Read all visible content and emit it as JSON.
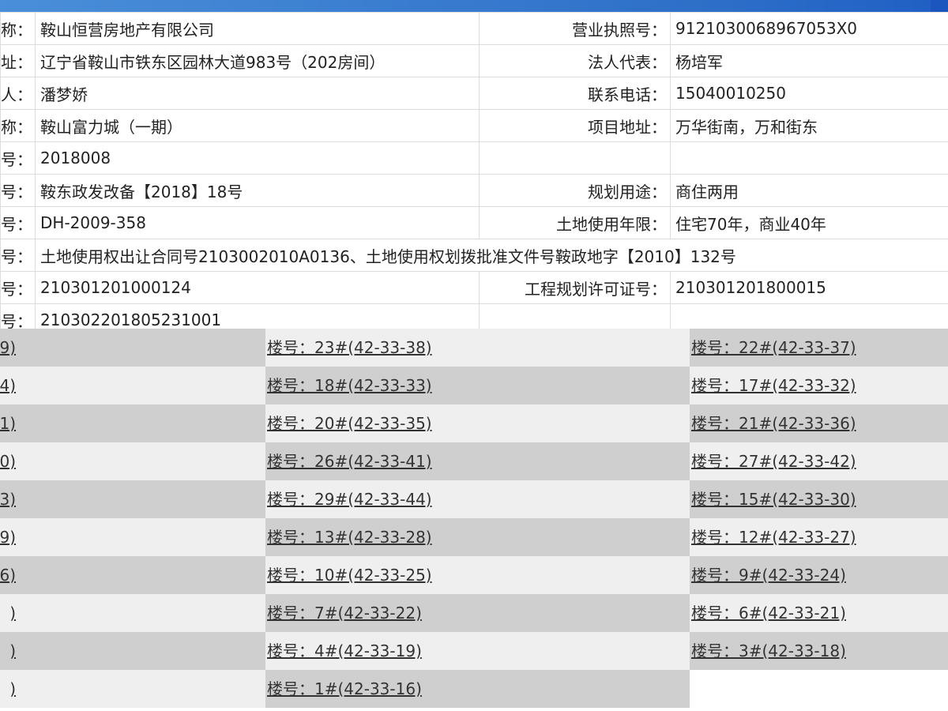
{
  "info_rows": [
    {
      "l1": "称：",
      "v1": "鞍山恒营房地产有限公司",
      "l2": "营业执照号：",
      "v2": "9121030068967053X0"
    },
    {
      "l1": "址：",
      "v1": "辽宁省鞍山市铁东区园林大道983号（202房间）",
      "l2": "法人代表：",
      "v2": "杨培军"
    },
    {
      "l1": "人：",
      "v1": "潘梦娇",
      "l2": "联系电话：",
      "v2": "15040010250"
    },
    {
      "l1": "称：",
      "v1": "鞍山富力城（一期）",
      "l2": "项目地址：",
      "v2": "万华街南，万和街东"
    },
    {
      "l1": "号：",
      "v1": "2018008",
      "l2": "",
      "v2": ""
    },
    {
      "l1": "号：",
      "v1": "鞍东政发改备【2018】18号",
      "l2": "规划用途：",
      "v2": "商住两用"
    },
    {
      "l1": "号：",
      "v1": "DH-2009-358",
      "l2": "土地使用年限：",
      "v2": "住宅70年，商业40年"
    },
    {
      "l1": "号：",
      "v1": "土地使用权出让合同号2103002010A0136、土地使用权划拨批准文件号鞍政地字【2010】132号",
      "l2": "",
      "v2": "",
      "span": true
    },
    {
      "l1": "号：",
      "v1": "210301201000124",
      "l2": "工程规划许可证号：",
      "v2": "210301201800015"
    },
    {
      "l1": "号：",
      "v1": "210302201805231001",
      "l2": "",
      "v2": ""
    }
  ],
  "buildings": [
    {
      "c1": "9)",
      "c2": "楼号：23#(42-33-38)",
      "c3": "楼号：22#(42-33-37)"
    },
    {
      "c1": "4)",
      "c2": "楼号：18#(42-33-33)",
      "c3": "楼号：17#(42-33-32)"
    },
    {
      "c1": "1)",
      "c2": "楼号：20#(42-33-35)",
      "c3": "楼号：21#(42-33-36)"
    },
    {
      "c1": "0)",
      "c2": "楼号：26#(42-33-41)",
      "c3": "楼号：27#(42-33-42)"
    },
    {
      "c1": "3)",
      "c2": "楼号：29#(42-33-44)",
      "c3": "楼号：15#(42-33-30)"
    },
    {
      "c1": "9)",
      "c2": "楼号：13#(42-33-28)",
      "c3": "楼号：12#(42-33-27)"
    },
    {
      "c1": "6)",
      "c2": "楼号：10#(42-33-25)",
      "c3": "楼号：9#(42-33-24)"
    },
    {
      "c1": ")",
      "c2": "楼号：7#(42-33-22)",
      "c3": "楼号：6#(42-33-21)"
    },
    {
      "c1": ")",
      "c2": "楼号：4#(42-33-19)",
      "c3": "楼号：3#(42-33-18)"
    },
    {
      "c1": ")",
      "c2": "楼号：1#(42-33-16)",
      "c3": ""
    }
  ]
}
